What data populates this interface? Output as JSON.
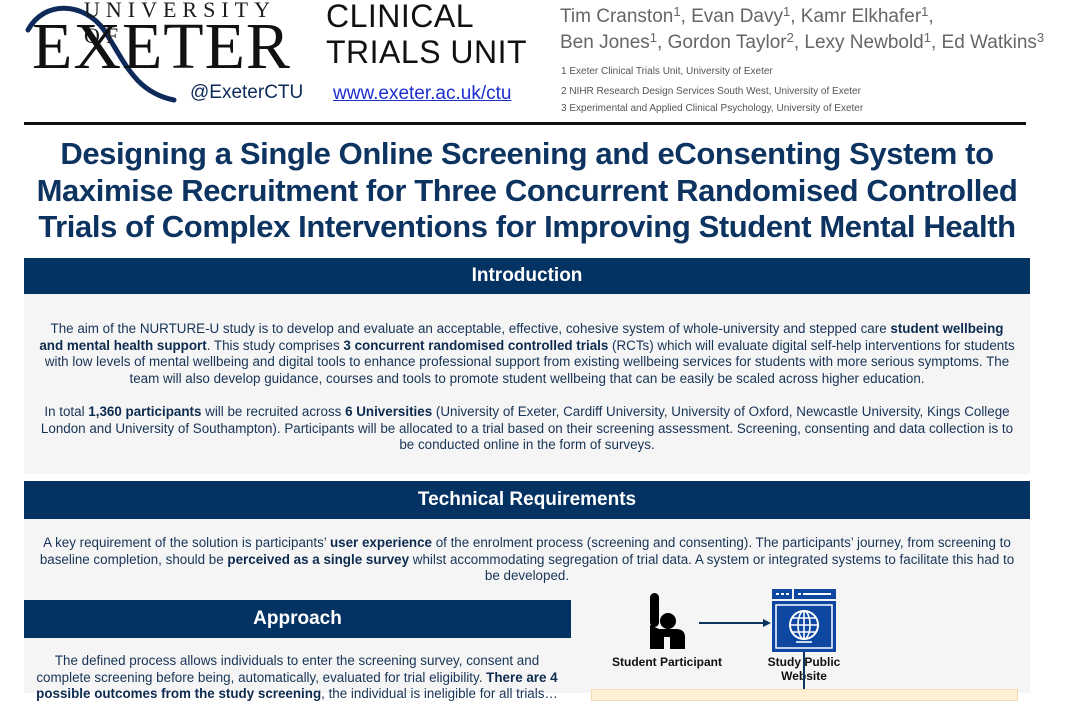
{
  "header": {
    "logo": {
      "line1": "UNIVERSITY OF",
      "line2": "EXETER",
      "handle": "@ExeterCTU"
    },
    "unit": {
      "line1": "CLINICAL",
      "line2": "TRIALS UNIT",
      "url": "www.exeter.ac.uk/ctu"
    },
    "authors": [
      {
        "name": "Tim Cranston",
        "aff": "1"
      },
      {
        "name": "Evan Davy",
        "aff": "1"
      },
      {
        "name": "Kamr Elkhafer",
        "aff": "1"
      },
      {
        "name": "Ben Jones",
        "aff": "1"
      },
      {
        "name": "Gordon Taylor",
        "aff": "2"
      },
      {
        "name": "Lexy Newbold",
        "aff": "1"
      },
      {
        "name": "Ed Watkins",
        "aff": "3"
      }
    ],
    "affiliations": [
      "1 Exeter Clinical Trials Unit, University of Exeter",
      "2 NIHR Research Design Services South West, University of Exeter",
      "3 Experimental and Applied Clinical Psychology, University of Exeter"
    ]
  },
  "title": "Designing a Single Online Screening and eConsenting System to Maximise Recruitment for Three Concurrent Randomised Controlled Trials of Complex Interventions for Improving Student Mental Health",
  "sections": {
    "introduction": {
      "heading": "Introduction",
      "p1": [
        {
          "t": "The aim of the NURTURE-U study is to develop and evaluate an acceptable, effective, cohesive system of whole-university and stepped care ",
          "b": false
        },
        {
          "t": "student wellbeing and mental health support",
          "b": true
        },
        {
          "t": ". This study comprises ",
          "b": false
        },
        {
          "t": "3 concurrent randomised controlled trials",
          "b": true
        },
        {
          "t": " (RCTs) which will evaluate digital self-help interventions for students with low levels of mental wellbeing and digital tools to enhance professional support from existing wellbeing services for students with more serious symptoms.  The team will also develop guidance, courses and tools to promote student wellbeing that can be easily be scaled across higher education.",
          "b": false
        }
      ],
      "p2": [
        {
          "t": "In total ",
          "b": false
        },
        {
          "t": "1,360 participants",
          "b": true
        },
        {
          "t": " will be recruited across ",
          "b": false
        },
        {
          "t": "6 Universities",
          "b": true
        },
        {
          "t": " (University of Exeter, Cardiff University, University of Oxford, Newcastle University, Kings College London and University of Southampton). Participants will be allocated to a trial based on their screening assessment. Screening, consenting and data collection is to be conducted online in the form of surveys.",
          "b": false
        }
      ]
    },
    "technical": {
      "heading": "Technical Requirements",
      "p": [
        {
          "t": "A key requirement of the solution is participants’ ",
          "b": false
        },
        {
          "t": "user experience",
          "b": true
        },
        {
          "t": " of the enrolment process (screening and consenting). The participants’ journey, from screening to baseline completion, should be ",
          "b": false
        },
        {
          "t": "perceived as a single survey",
          "b": true
        },
        {
          "t": " whilst accommodating segregation of trial data. A system or integrated systems to facilitate this had to be developed.",
          "b": false
        }
      ]
    },
    "approach": {
      "heading": "Approach",
      "p": [
        {
          "t": "The defined process allows individuals to enter the screening survey, consent and complete screening before being, automatically, evaluated for trial eligibility. ",
          "b": false
        },
        {
          "t": "There are 4 possible outcomes from the study screening",
          "b": true
        },
        {
          "t": ", the individual is ineligible for all trials…",
          "b": false
        }
      ]
    }
  },
  "diagram": {
    "participant_label": "Student Participant",
    "website_label": "Study Public Website",
    "icons": [
      "raised-hand-person-icon",
      "web-browser-globe-icon"
    ],
    "accent": "#0d47a1"
  },
  "colors": {
    "header_bar": "#043263",
    "title": "#0d3461",
    "body_bg": "#f5f5f5",
    "link": "#1c2fd0"
  }
}
